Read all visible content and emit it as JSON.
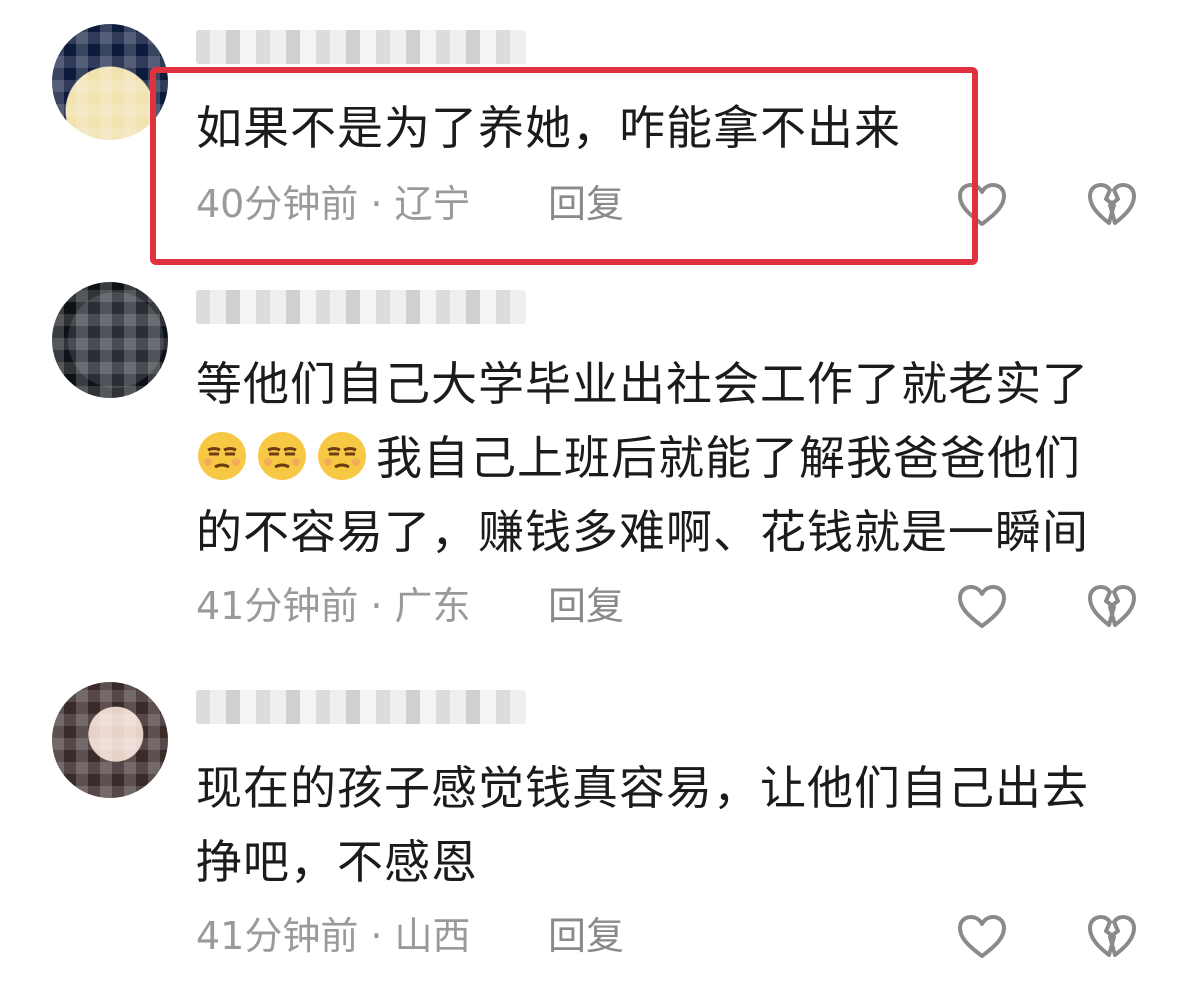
{
  "comments": [
    {
      "text": "如果不是为了养她，咋能拿不出来",
      "time": "40分钟前",
      "location": "辽宁",
      "reply": "回复",
      "highlighted": true,
      "avatar_colors": [
        "#0d1b3d",
        "#f1e2b0"
      ]
    },
    {
      "text_line1": "等他们自己大学毕业出社会工作了就老实了",
      "text_line2": "我自己上班后就能了解我爸爸他们",
      "text_line3": "的不容易了，赚钱多难啊、花钱就是一瞬间",
      "emoji": [
        "smirk-emoji",
        "smirk-emoji",
        "smirk-emoji"
      ],
      "time": "41分钟前",
      "location": "广东",
      "reply": "回复",
      "avatar_colors": [
        "#2a2f36",
        "#0e1116"
      ]
    },
    {
      "text_line1": "现在的孩子感觉钱真容易，让他们自己出去",
      "text_line2": "挣吧，不感恩",
      "time": "41分钟前",
      "location": "山西",
      "reply": "回复",
      "avatar_colors": [
        "#3a2a2a",
        "#e8d2c8"
      ]
    }
  ],
  "meta_separator": "·",
  "colors": {
    "highlight_border": "#e0323e",
    "meta_text": "#9a9a9a",
    "icon_stroke": "#8a8a8a",
    "emoji_fill": "#f7c843"
  },
  "icons": {
    "like": "heart-outline-icon",
    "dislike": "broken-heart-icon"
  }
}
